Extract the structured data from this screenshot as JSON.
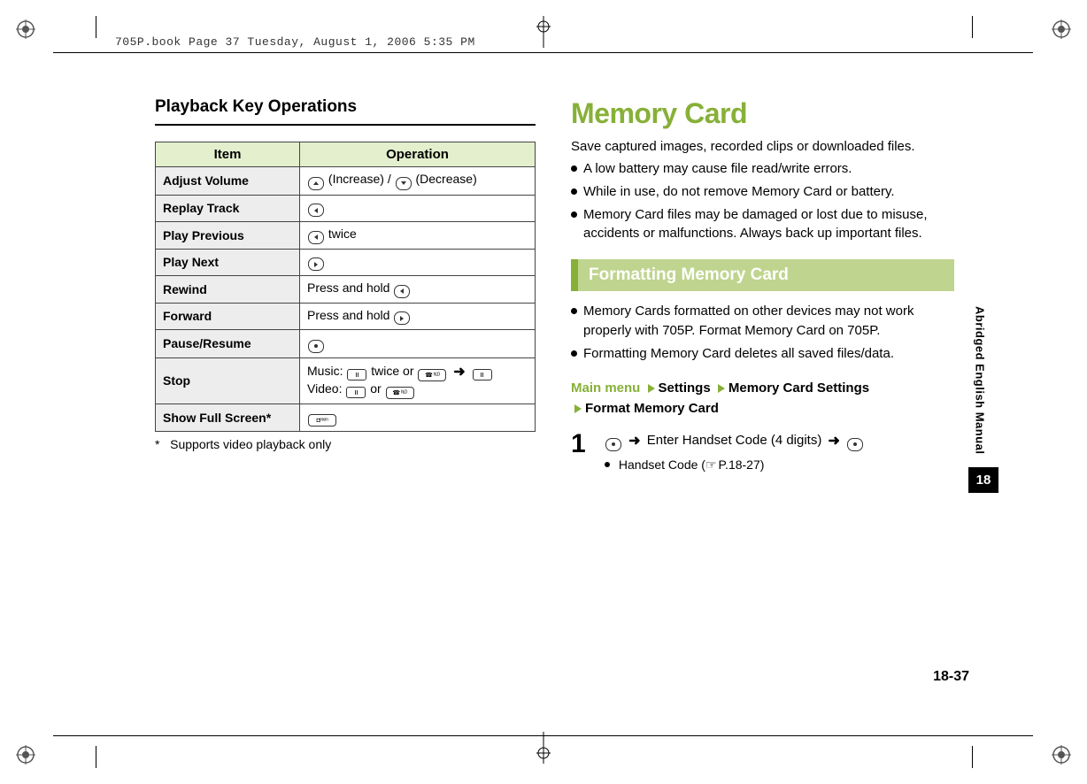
{
  "meta": {
    "header": "705P.book  Page 37  Tuesday, August 1, 2006  5:35 PM",
    "side_label": "Abridged English Manual",
    "chapter": "18",
    "page_number": "18-37"
  },
  "left": {
    "heading": "Playback Key Operations",
    "table_headers": {
      "item": "Item",
      "operation": "Operation"
    },
    "rows": [
      {
        "item": "Adjust Volume",
        "op_parts": [
          "icon:up",
          " (Increase) / ",
          "icon:down",
          " (Decrease)"
        ]
      },
      {
        "item": "Replay Track",
        "op_parts": [
          "icon:left"
        ]
      },
      {
        "item": "Play Previous",
        "op_parts": [
          "icon:left",
          " twice"
        ]
      },
      {
        "item": "Play Next",
        "op_parts": [
          "icon:right"
        ]
      },
      {
        "item": "Rewind",
        "op_parts": [
          "Press and hold ",
          "icon:left"
        ]
      },
      {
        "item": "Forward",
        "op_parts": [
          "Press and hold ",
          "icon:right"
        ]
      },
      {
        "item": "Pause/Resume",
        "op_parts": [
          "icon:center"
        ]
      },
      {
        "item": "Stop",
        "op_parts": [
          "Music: ",
          "icon:rect",
          " twice or ",
          "icon:call",
          " ",
          "arrow",
          " ",
          "icon:rect",
          "\nVideo: ",
          "icon:rect",
          " or ",
          "icon:call"
        ]
      },
      {
        "item": "Show Full Screen*",
        "op_parts": [
          "icon:camera"
        ]
      }
    ],
    "footnote_marker": "*",
    "footnote_text": "Supports video playback only"
  },
  "right": {
    "heading": "Memory Card",
    "intro": "Save captured images, recorded clips or downloaded files.",
    "bullets1": [
      "A low battery may cause file read/write errors.",
      "While in use, do not remove Memory Card or battery.",
      "Memory Card files may be damaged or lost due to misuse, accidents or malfunctions. Always back up important files."
    ],
    "sub_heading": "Formatting Memory Card",
    "bullets2": [
      "Memory Cards formatted on other devices may not work properly with 705P. Format Memory Card on 705P.",
      "Formatting Memory Card deletes all saved files/data."
    ],
    "menu_path": [
      "Main menu",
      "Settings",
      "Memory Card Settings",
      "Format Memory Card"
    ],
    "step": {
      "num": "1",
      "body_parts": [
        "icon:center",
        " ",
        "arrow",
        " Enter Handset Code (4 digits) ",
        "arrow",
        " ",
        "icon:center"
      ],
      "sub_prefix": "Handset Code (",
      "sub_ref": "P.18-27",
      "sub_suffix": ")"
    }
  }
}
